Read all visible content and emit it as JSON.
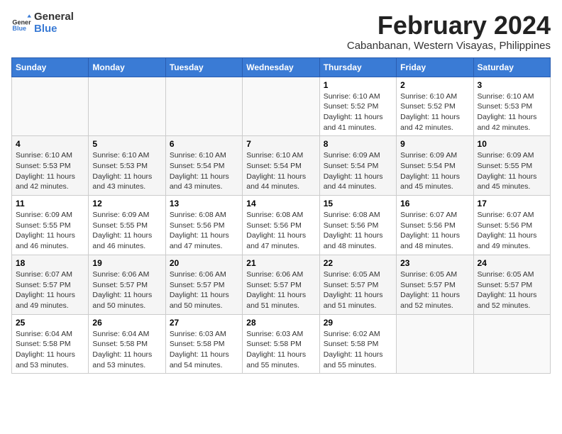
{
  "logo": {
    "line1": "General",
    "line2": "Blue"
  },
  "title": "February 2024",
  "location": "Cabanbanan, Western Visayas, Philippines",
  "header_days": [
    "Sunday",
    "Monday",
    "Tuesday",
    "Wednesday",
    "Thursday",
    "Friday",
    "Saturday"
  ],
  "weeks": [
    [
      {
        "day": "",
        "info": ""
      },
      {
        "day": "",
        "info": ""
      },
      {
        "day": "",
        "info": ""
      },
      {
        "day": "",
        "info": ""
      },
      {
        "day": "1",
        "info": "Sunrise: 6:10 AM\nSunset: 5:52 PM\nDaylight: 11 hours and 41 minutes."
      },
      {
        "day": "2",
        "info": "Sunrise: 6:10 AM\nSunset: 5:52 PM\nDaylight: 11 hours and 42 minutes."
      },
      {
        "day": "3",
        "info": "Sunrise: 6:10 AM\nSunset: 5:53 PM\nDaylight: 11 hours and 42 minutes."
      }
    ],
    [
      {
        "day": "4",
        "info": "Sunrise: 6:10 AM\nSunset: 5:53 PM\nDaylight: 11 hours and 42 minutes."
      },
      {
        "day": "5",
        "info": "Sunrise: 6:10 AM\nSunset: 5:53 PM\nDaylight: 11 hours and 43 minutes."
      },
      {
        "day": "6",
        "info": "Sunrise: 6:10 AM\nSunset: 5:54 PM\nDaylight: 11 hours and 43 minutes."
      },
      {
        "day": "7",
        "info": "Sunrise: 6:10 AM\nSunset: 5:54 PM\nDaylight: 11 hours and 44 minutes."
      },
      {
        "day": "8",
        "info": "Sunrise: 6:09 AM\nSunset: 5:54 PM\nDaylight: 11 hours and 44 minutes."
      },
      {
        "day": "9",
        "info": "Sunrise: 6:09 AM\nSunset: 5:54 PM\nDaylight: 11 hours and 45 minutes."
      },
      {
        "day": "10",
        "info": "Sunrise: 6:09 AM\nSunset: 5:55 PM\nDaylight: 11 hours and 45 minutes."
      }
    ],
    [
      {
        "day": "11",
        "info": "Sunrise: 6:09 AM\nSunset: 5:55 PM\nDaylight: 11 hours and 46 minutes."
      },
      {
        "day": "12",
        "info": "Sunrise: 6:09 AM\nSunset: 5:55 PM\nDaylight: 11 hours and 46 minutes."
      },
      {
        "day": "13",
        "info": "Sunrise: 6:08 AM\nSunset: 5:56 PM\nDaylight: 11 hours and 47 minutes."
      },
      {
        "day": "14",
        "info": "Sunrise: 6:08 AM\nSunset: 5:56 PM\nDaylight: 11 hours and 47 minutes."
      },
      {
        "day": "15",
        "info": "Sunrise: 6:08 AM\nSunset: 5:56 PM\nDaylight: 11 hours and 48 minutes."
      },
      {
        "day": "16",
        "info": "Sunrise: 6:07 AM\nSunset: 5:56 PM\nDaylight: 11 hours and 48 minutes."
      },
      {
        "day": "17",
        "info": "Sunrise: 6:07 AM\nSunset: 5:56 PM\nDaylight: 11 hours and 49 minutes."
      }
    ],
    [
      {
        "day": "18",
        "info": "Sunrise: 6:07 AM\nSunset: 5:57 PM\nDaylight: 11 hours and 49 minutes."
      },
      {
        "day": "19",
        "info": "Sunrise: 6:06 AM\nSunset: 5:57 PM\nDaylight: 11 hours and 50 minutes."
      },
      {
        "day": "20",
        "info": "Sunrise: 6:06 AM\nSunset: 5:57 PM\nDaylight: 11 hours and 50 minutes."
      },
      {
        "day": "21",
        "info": "Sunrise: 6:06 AM\nSunset: 5:57 PM\nDaylight: 11 hours and 51 minutes."
      },
      {
        "day": "22",
        "info": "Sunrise: 6:05 AM\nSunset: 5:57 PM\nDaylight: 11 hours and 51 minutes."
      },
      {
        "day": "23",
        "info": "Sunrise: 6:05 AM\nSunset: 5:57 PM\nDaylight: 11 hours and 52 minutes."
      },
      {
        "day": "24",
        "info": "Sunrise: 6:05 AM\nSunset: 5:57 PM\nDaylight: 11 hours and 52 minutes."
      }
    ],
    [
      {
        "day": "25",
        "info": "Sunrise: 6:04 AM\nSunset: 5:58 PM\nDaylight: 11 hours and 53 minutes."
      },
      {
        "day": "26",
        "info": "Sunrise: 6:04 AM\nSunset: 5:58 PM\nDaylight: 11 hours and 53 minutes."
      },
      {
        "day": "27",
        "info": "Sunrise: 6:03 AM\nSunset: 5:58 PM\nDaylight: 11 hours and 54 minutes."
      },
      {
        "day": "28",
        "info": "Sunrise: 6:03 AM\nSunset: 5:58 PM\nDaylight: 11 hours and 55 minutes."
      },
      {
        "day": "29",
        "info": "Sunrise: 6:02 AM\nSunset: 5:58 PM\nDaylight: 11 hours and 55 minutes."
      },
      {
        "day": "",
        "info": ""
      },
      {
        "day": "",
        "info": ""
      }
    ]
  ]
}
